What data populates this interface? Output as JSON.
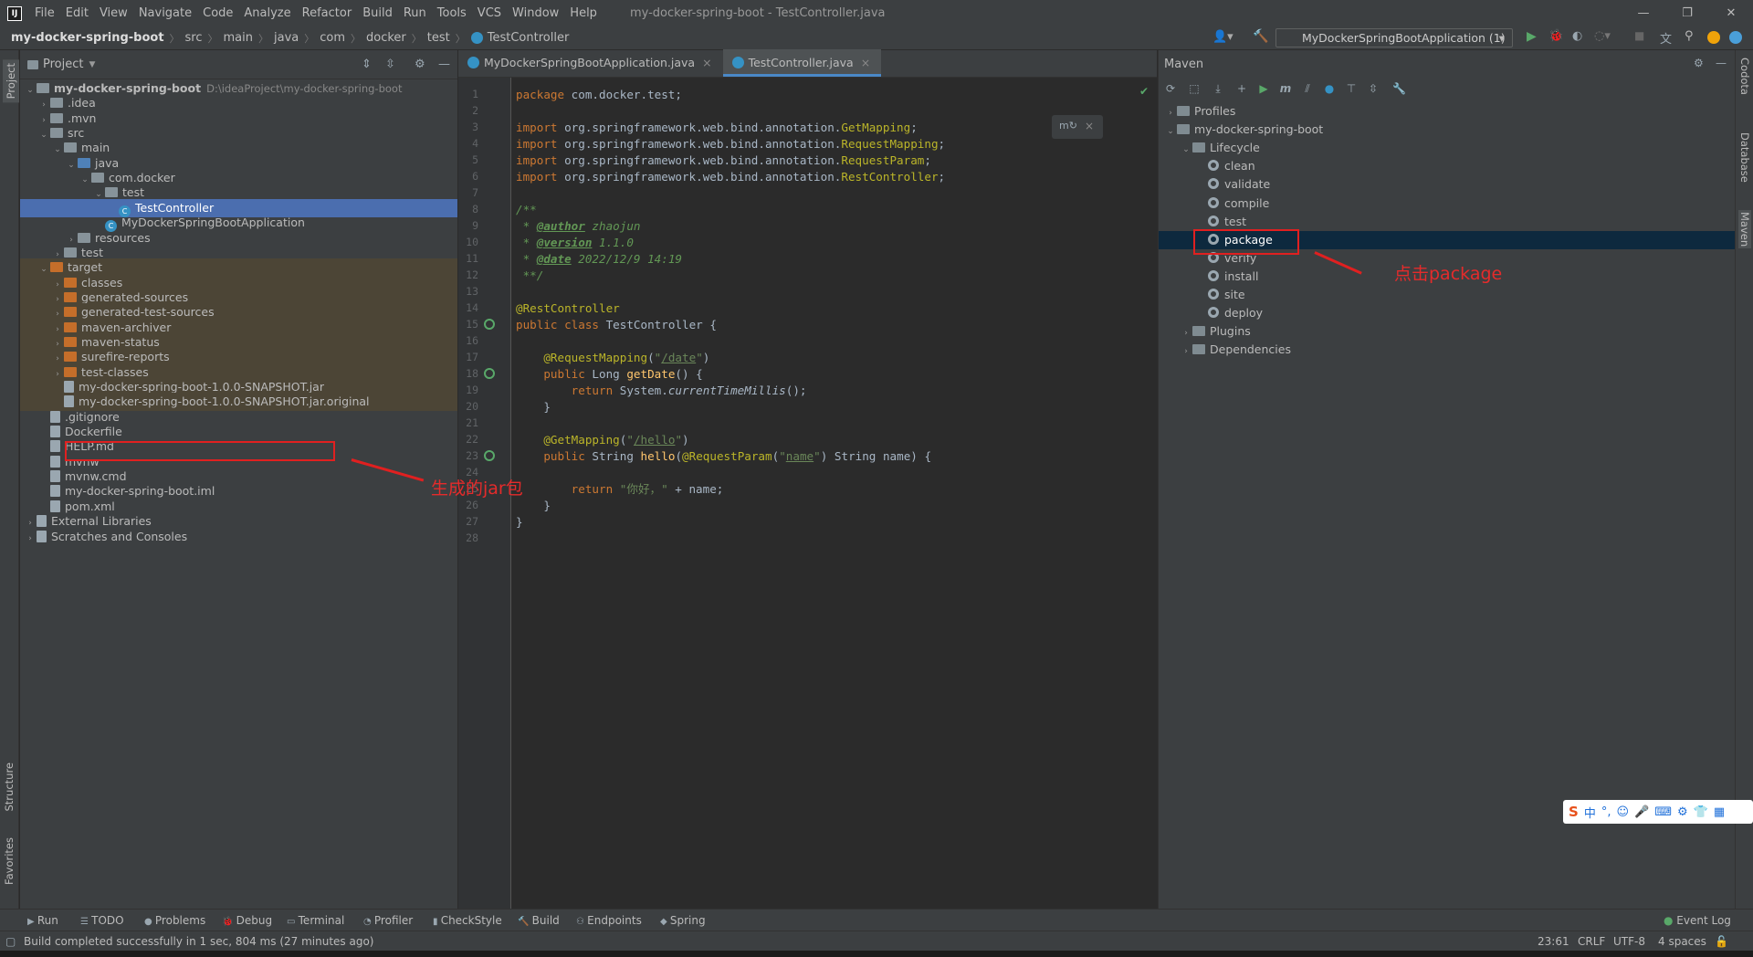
{
  "menu": [
    "File",
    "Edit",
    "View",
    "Navigate",
    "Code",
    "Analyze",
    "Refactor",
    "Build",
    "Run",
    "Tools",
    "VCS",
    "Window",
    "Help"
  ],
  "window_title": "my-docker-spring-boot - TestController.java",
  "breadcrumbs": [
    "my-docker-spring-boot",
    "src",
    "main",
    "java",
    "com",
    "docker",
    "test",
    "TestController"
  ],
  "run_config": "MyDockerSpringBootApplication (1)",
  "project": {
    "header": "Project",
    "root_path": "D:\\ideaProject\\my-docker-spring-boot",
    "rows": [
      {
        "label": "my-docker-spring-boot",
        "chev": "v",
        "icon": "folder",
        "bold": true
      },
      {
        "label": ".idea",
        "chev": ">",
        "icon": "folder"
      },
      {
        "label": ".mvn",
        "chev": ">",
        "icon": "folder"
      },
      {
        "label": "src",
        "chev": "v",
        "icon": "folder"
      },
      {
        "label": "main",
        "chev": "v",
        "icon": "folder"
      },
      {
        "label": "java",
        "chev": "v",
        "icon": "folder-blue"
      },
      {
        "label": "com.docker",
        "chev": "v",
        "icon": "folder"
      },
      {
        "label": "test",
        "chev": "v",
        "icon": "folder"
      },
      {
        "label": "TestController",
        "chev": "",
        "icon": "class",
        "selected": true
      },
      {
        "label": "MyDockerSpringBootApplication",
        "chev": "",
        "icon": "class"
      },
      {
        "label": "resources",
        "chev": ">",
        "icon": "folder"
      },
      {
        "label": "test",
        "chev": ">",
        "icon": "folder"
      },
      {
        "label": "target",
        "chev": "v",
        "icon": "folder-orange",
        "target": true
      },
      {
        "label": "classes",
        "chev": ">",
        "icon": "folder-orange",
        "target": true
      },
      {
        "label": "generated-sources",
        "chev": ">",
        "icon": "folder-orange",
        "target": true
      },
      {
        "label": "generated-test-sources",
        "chev": ">",
        "icon": "folder-orange",
        "target": true
      },
      {
        "label": "maven-archiver",
        "chev": ">",
        "icon": "folder-orange",
        "target": true
      },
      {
        "label": "maven-status",
        "chev": ">",
        "icon": "folder-orange",
        "target": true
      },
      {
        "label": "surefire-reports",
        "chev": ">",
        "icon": "folder-orange",
        "target": true
      },
      {
        "label": "test-classes",
        "chev": ">",
        "icon": "folder-orange",
        "target": true
      },
      {
        "label": "my-docker-spring-boot-1.0.0-SNAPSHOT.jar",
        "chev": "",
        "icon": "file",
        "target": true
      },
      {
        "label": "my-docker-spring-boot-1.0.0-SNAPSHOT.jar.original",
        "chev": "",
        "icon": "file",
        "target": true
      },
      {
        "label": ".gitignore",
        "chev": "",
        "icon": "file"
      },
      {
        "label": "Dockerfile",
        "chev": "",
        "icon": "file"
      },
      {
        "label": "HELP.md",
        "chev": "",
        "icon": "file"
      },
      {
        "label": "mvnw",
        "chev": "",
        "icon": "file"
      },
      {
        "label": "mvnw.cmd",
        "chev": "",
        "icon": "file"
      },
      {
        "label": "my-docker-spring-boot.iml",
        "chev": "",
        "icon": "file"
      },
      {
        "label": "pom.xml",
        "chev": "",
        "icon": "file"
      },
      {
        "label": "External Libraries",
        "chev": ">",
        "icon": "file"
      },
      {
        "label": "Scratches and Consoles",
        "chev": ">",
        "icon": "file"
      }
    ]
  },
  "editor_tabs": [
    "MyDockerSpringBootApplication.java",
    "TestController.java"
  ],
  "code_lines": [
    "<span class='kw'>package</span> com.docker.test;",
    "",
    "<span class='kw'>import</span> org.springframework.web.bind.annotation.<span class='ann'>GetMapping</span>;",
    "<span class='kw'>import</span> org.springframework.web.bind.annotation.<span class='ann'>RequestMapping</span>;",
    "<span class='kw'>import</span> org.springframework.web.bind.annotation.<span class='ann'>RequestParam</span>;",
    "<span class='kw'>import</span> org.springframework.web.bind.annotation.<span class='ann'>RestController</span>;",
    "",
    "<span class='cmt'>/**</span>",
    "<span class='cmt'> * </span><span class='tag'>@author</span><span class='cmt'> zhaojun</span>",
    "<span class='cmt'> * </span><span class='tag'>@version</span><span class='cmt'> 1.1.0</span>",
    "<span class='cmt'> * </span><span class='tag'>@date</span><span class='cmt'> 2022/12/9 14:19</span>",
    "<span class='cmt'> **/</span>",
    "",
    "<span class='ann'>@RestController</span>",
    "<span class='kw'>public class</span> TestController {",
    "",
    "    <span class='ann'>@RequestMapping</span>(<span class='str'>\"<span class='ul'>/date</span>\"</span>)",
    "    <span class='kw'>public</span> Long <span class='fn'>getDate</span>() {",
    "        <span class='kw'>return</span> System.<span class='st'>currentTimeMillis</span>();",
    "    }",
    "",
    "    <span class='ann'>@GetMapping</span>(<span class='str'>\"<span class='ul'>/hello</span>\"</span>)",
    "    <span class='kw'>public</span> String <span class='fn'>hello</span>(<span class='ann'>@RequestParam</span>(<span class='str'>\"<span class='ul'>name</span>\"</span>) String name) {",
    "",
    "        <span class='kw'>return</span> <span class='str'>\"你好，\"</span> + name;",
    "    }",
    "}",
    ""
  ],
  "maven": {
    "header": "Maven",
    "rows": [
      {
        "label": "Profiles",
        "chev": ">",
        "indent": 0
      },
      {
        "label": "my-docker-spring-boot",
        "chev": "v",
        "indent": 0
      },
      {
        "label": "Lifecycle",
        "chev": "v",
        "indent": 1
      },
      {
        "label": "clean",
        "chev": "",
        "indent": 2,
        "gear": true
      },
      {
        "label": "validate",
        "chev": "",
        "indent": 2,
        "gear": true
      },
      {
        "label": "compile",
        "chev": "",
        "indent": 2,
        "gear": true
      },
      {
        "label": "test",
        "chev": "",
        "indent": 2,
        "gear": true
      },
      {
        "label": "package",
        "chev": "",
        "indent": 2,
        "gear": true,
        "selected": true
      },
      {
        "label": "verify",
        "chev": "",
        "indent": 2,
        "gear": true
      },
      {
        "label": "install",
        "chev": "",
        "indent": 2,
        "gear": true
      },
      {
        "label": "site",
        "chev": "",
        "indent": 2,
        "gear": true
      },
      {
        "label": "deploy",
        "chev": "",
        "indent": 2,
        "gear": true
      },
      {
        "label": "Plugins",
        "chev": ">",
        "indent": 1
      },
      {
        "label": "Dependencies",
        "chev": ">",
        "indent": 1
      }
    ]
  },
  "annotations": {
    "jar": "生成的jar包",
    "package": "点击package"
  },
  "left_stripe": {
    "project": "Project",
    "structure": "Structure",
    "favorites": "Favorites"
  },
  "right_stripe": {
    "codota": "Codota",
    "database": "Database",
    "maven": "Maven"
  },
  "bottom_tabs": [
    "Run",
    "TODO",
    "Problems",
    "Debug",
    "Terminal",
    "Profiler",
    "CheckStyle",
    "Build",
    "Endpoints",
    "Spring"
  ],
  "event_log": "Event Log",
  "status": {
    "message": "Build completed successfully in 1 sec, 804 ms (27 minutes ago)",
    "position": "23:61",
    "line_sep": "CRLF",
    "encoding": "UTF-8",
    "indent": "4 spaces"
  },
  "ime": {
    "lang": "中"
  },
  "colors": {
    "selection": "#4b6eaf",
    "accent": "#4a88c7",
    "annotation_red": "#e02020",
    "maven_selected": "#0d293e",
    "target_bg": "#4c4536"
  }
}
